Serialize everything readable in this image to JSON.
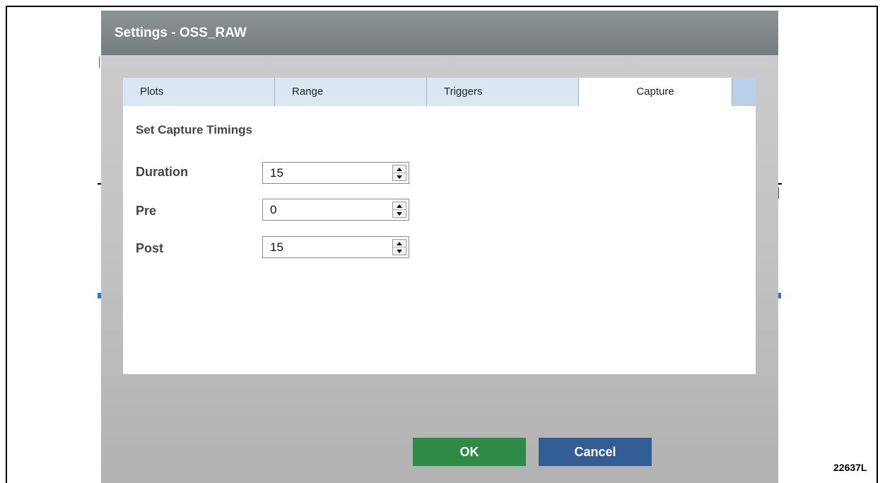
{
  "dialog": {
    "title": "Settings - OSS_RAW",
    "tabs": [
      {
        "label": "Plots",
        "active": false
      },
      {
        "label": "Range",
        "active": false
      },
      {
        "label": "Triggers",
        "active": false
      },
      {
        "label": "Capture",
        "active": true
      }
    ],
    "section_title": "Set Capture Timings",
    "fields": [
      {
        "label": "Duration",
        "value": "15"
      },
      {
        "label": "Pre",
        "value": "0"
      },
      {
        "label": "Post",
        "value": "15"
      }
    ],
    "buttons": {
      "ok_label": "OK",
      "cancel_label": "Cancel"
    }
  },
  "figure_id": "22637L",
  "colors": {
    "titlebar": "#7f8687",
    "tab_strip": "#dae6f3",
    "ok_button": "#2e8b45",
    "cancel_button": "#325d95"
  }
}
